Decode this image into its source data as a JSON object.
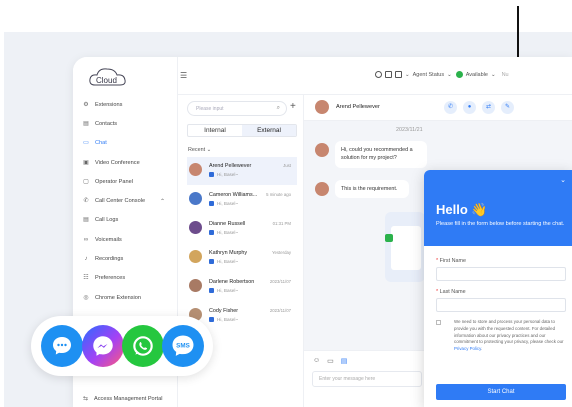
{
  "sidebar": {
    "logo_text": "Cloud",
    "items": [
      {
        "label": "Extensions",
        "icon": "extensions-icon"
      },
      {
        "label": "Contacts",
        "icon": "contacts-icon"
      },
      {
        "label": "Chat",
        "icon": "chat-icon",
        "active": true
      },
      {
        "label": "Video Conference",
        "icon": "video-icon"
      },
      {
        "label": "Operator Panel",
        "icon": "operator-icon"
      },
      {
        "label": "Call Center Console",
        "icon": "phone-icon"
      },
      {
        "label": "Call Logs",
        "icon": "logs-icon"
      },
      {
        "label": "Voicemails",
        "icon": "voicemail-icon"
      },
      {
        "label": "Recordings",
        "icon": "recording-icon"
      },
      {
        "label": "Preferences",
        "icon": "preferences-icon"
      },
      {
        "label": "Chrome Extension",
        "icon": "chrome-icon"
      }
    ],
    "bottom_item": "Access Management Portal"
  },
  "topbar": {
    "agent_status": "Agent Status",
    "available": "Available",
    "extra": "Nu"
  },
  "chatlist": {
    "search_placeholder": "Please input",
    "tabs": [
      "Internal",
      "External"
    ],
    "recent": "Recent",
    "conversations": [
      {
        "name": "Arend Pellewever",
        "time": "Just",
        "preview": "Hi, Basel~",
        "color": "#c7866f",
        "selected": true
      },
      {
        "name": "Cameron Williams...",
        "time": "5 minute ago",
        "preview": "Hi, Basel~",
        "color": "#4a78c9"
      },
      {
        "name": "Dianne Russell",
        "time": "01:31 PM",
        "preview": "Hi, Basel~",
        "color": "#6d4c8c"
      },
      {
        "name": "Kathryn Murphy",
        "time": "Yesterday",
        "preview": "Hi, Basel~",
        "color": "#d2a55d"
      },
      {
        "name": "Darlene Robertson",
        "time": "2023/11/07",
        "preview": "Hi, Basel~",
        "color": "#a87a64"
      },
      {
        "name": "Cody Fisher",
        "time": "2023/11/07",
        "preview": "Hi, Basel~",
        "color": "#b58f73"
      }
    ]
  },
  "conversation": {
    "name": "Arend Pellewever",
    "date": "2023/11/21",
    "messages": [
      "Hi, could you recommended a solution for my project?",
      "This is the requirement."
    ],
    "input_placeholder": "Enter your message here"
  },
  "widget": {
    "hello": "Hello 👋",
    "subtitle": "Please fill in the form below before starting the chat.",
    "first_name_label": "First Name",
    "last_name_label": "Last Name",
    "terms_text": "We need to store and process your personal data to provide you with the requested content. For detailed information about our privacy practices and our commitment to protecting your privacy, please check our",
    "privacy_link": "Privacy Policy",
    "terms_end": ".",
    "start_button": "Start Chat"
  },
  "channels": [
    {
      "name": "messenger-chat-icon",
      "color": "#1e90f2"
    },
    {
      "name": "messenger-icon",
      "color": "#a341f5"
    },
    {
      "name": "whatsapp-icon",
      "color": "#25c73f"
    },
    {
      "name": "sms-icon",
      "color": "#1e90f2",
      "label": "SMS"
    }
  ]
}
